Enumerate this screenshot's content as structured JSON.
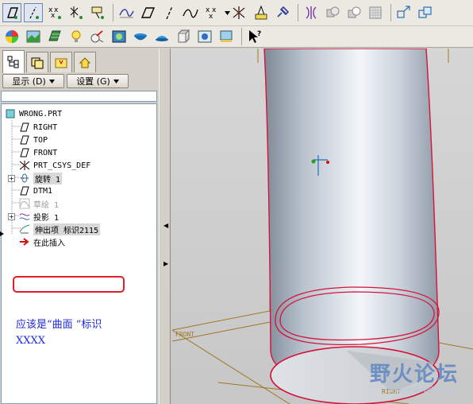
{
  "toolbar": {
    "row1_icons": [
      "datum-plane-icon",
      "datum-axis-icon",
      "datum-point-icon",
      "coordinate-system-icon",
      "datum-plane-display-icon",
      "curve-icon",
      "plane-icon",
      "axis-icon",
      "spline-icon",
      "point-icon",
      "dropdown-icon",
      "csys-icon",
      "analysis-icon",
      "link-icon",
      "mirror-icon",
      "merge-icon",
      "intersect-icon",
      "grid-icon",
      "view-icon",
      "layer-icon"
    ],
    "row2_icons": [
      "color-icon",
      "appearance-icon",
      "texture-icon",
      "light-icon",
      "model-tree-icon",
      "render-icon",
      "bowl-icon",
      "hat-icon",
      "box-icon",
      "sphere-icon",
      "photo-icon",
      "help-cursor-icon"
    ]
  },
  "panel": {
    "tabs": [
      "model-tree-tab",
      "layers-tab",
      "folder-tab",
      "favorites-tab"
    ],
    "show_menu": "显示 (D)",
    "settings_menu": "设置 (G)"
  },
  "tree": {
    "root": "WRONG.PRT",
    "items": [
      {
        "label": "RIGHT",
        "icon": "datum-plane-icon"
      },
      {
        "label": "TOP",
        "icon": "datum-plane-icon"
      },
      {
        "label": "FRONT",
        "icon": "datum-plane-icon"
      },
      {
        "label": "PRT_CSYS_DEF",
        "icon": "csys-icon"
      },
      {
        "label": "旋转 1",
        "icon": "revolve-icon",
        "expandable": true
      },
      {
        "label": "DTM1",
        "icon": "datum-plane-icon"
      },
      {
        "label": "草绘 1",
        "icon": "sketch-icon",
        "suppressed": true
      },
      {
        "label": "投影 1",
        "icon": "projection-icon",
        "expandable": true
      },
      {
        "label": "伸出项 标识2115",
        "icon": "protrusion-icon",
        "annotated": true
      },
      {
        "label": "在此插入",
        "icon": "insert-arrow-icon"
      }
    ]
  },
  "annotation": {
    "line1": "应该是“曲面 ”标识",
    "line2": "XXXX"
  },
  "viewport": {
    "front_label": "FRONT",
    "right_label": "RIGHT",
    "watermark_title": "野火论坛",
    "watermark_url": "www.proewildfire.cn",
    "colors": {
      "edge": "#d4123a",
      "datum": "#a07820",
      "surface_light": "#f2f5f9",
      "surface_dark": "#8b96a3"
    }
  }
}
